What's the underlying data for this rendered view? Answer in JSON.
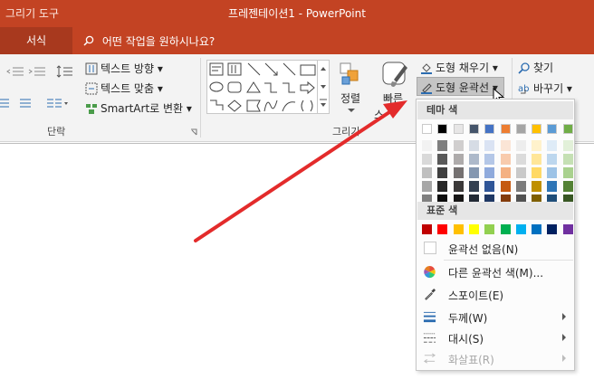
{
  "titlebar": {
    "tool_tab": "그리기 도구",
    "title": "프레젠테이션1  -  PowerPoint",
    "bg_color": "#c34323"
  },
  "tellrow": {
    "tab_format": "서식",
    "tell_me_placeholder": "어떤 작업을 원하시나요?"
  },
  "ribbon": {
    "paragraph": {
      "text_direction": "텍스트 방향 ▾",
      "align_text": "텍스트 맞춤 ▾",
      "smartart": "SmartArt로 변환 ▾",
      "label": "단락"
    },
    "drawing": {
      "arrange": "정렬",
      "quick_styles_line1": "빠른",
      "quick_styles_line2": "스",
      "shape_fill": "도형 채우기 ▾",
      "shape_outline": "도형 윤곽선 ▾",
      "label": "그리기"
    },
    "editing": {
      "find": "찾기",
      "replace": "바꾸기 ▾"
    }
  },
  "menu": {
    "theme_colors_header": "테마 색",
    "standard_colors_header": "표준 색",
    "theme_top_row": [
      "#ffffff",
      "#000000",
      "#e7e6e6",
      "#44546a",
      "#4472c4",
      "#ed7d31",
      "#a5a5a5",
      "#ffc000",
      "#5b9bd5",
      "#70ad47"
    ],
    "theme_shades": [
      [
        "#f2f2f2",
        "#d9d9d9",
        "#bfbfbf",
        "#a6a6a6",
        "#808080"
      ],
      [
        "#7f7f7f",
        "#595959",
        "#3f3f3f",
        "#262626",
        "#0d0d0d"
      ],
      [
        "#d0cece",
        "#aeabab",
        "#757171",
        "#3a3838",
        "#171616"
      ],
      [
        "#d6dce5",
        "#adb9ca",
        "#8497b0",
        "#333f50",
        "#222a35"
      ],
      [
        "#dae3f3",
        "#b4c7e7",
        "#8faadc",
        "#2f5597",
        "#1f3864"
      ],
      [
        "#fbe5d6",
        "#f8cbad",
        "#f4b183",
        "#c55a11",
        "#843c0c"
      ],
      [
        "#ededed",
        "#dbdbdb",
        "#c9c9c9",
        "#7b7b7b",
        "#525252"
      ],
      [
        "#fff2cc",
        "#ffe699",
        "#ffd966",
        "#bf9000",
        "#7f6000"
      ],
      [
        "#deebf7",
        "#bdd7ee",
        "#9dc3e6",
        "#2e75b6",
        "#1f4e79"
      ],
      [
        "#e2f0d9",
        "#c5e0b4",
        "#a9d18e",
        "#548235",
        "#385723"
      ]
    ],
    "standard": [
      "#c00000",
      "#ff0000",
      "#ffc000",
      "#ffff00",
      "#92d050",
      "#00b050",
      "#00b0f0",
      "#0070c0",
      "#002060",
      "#7030a0"
    ],
    "no_outline": "윤곽선 없음(N)",
    "more_colors": "다른 윤곽선 색(M)...",
    "eyedropper": "스포이트(E)",
    "weight": "두께(W)",
    "dashes": "대시(S)",
    "arrows": "화살표(R)"
  },
  "annotation": {
    "arrow_color": "#e32b2b"
  }
}
